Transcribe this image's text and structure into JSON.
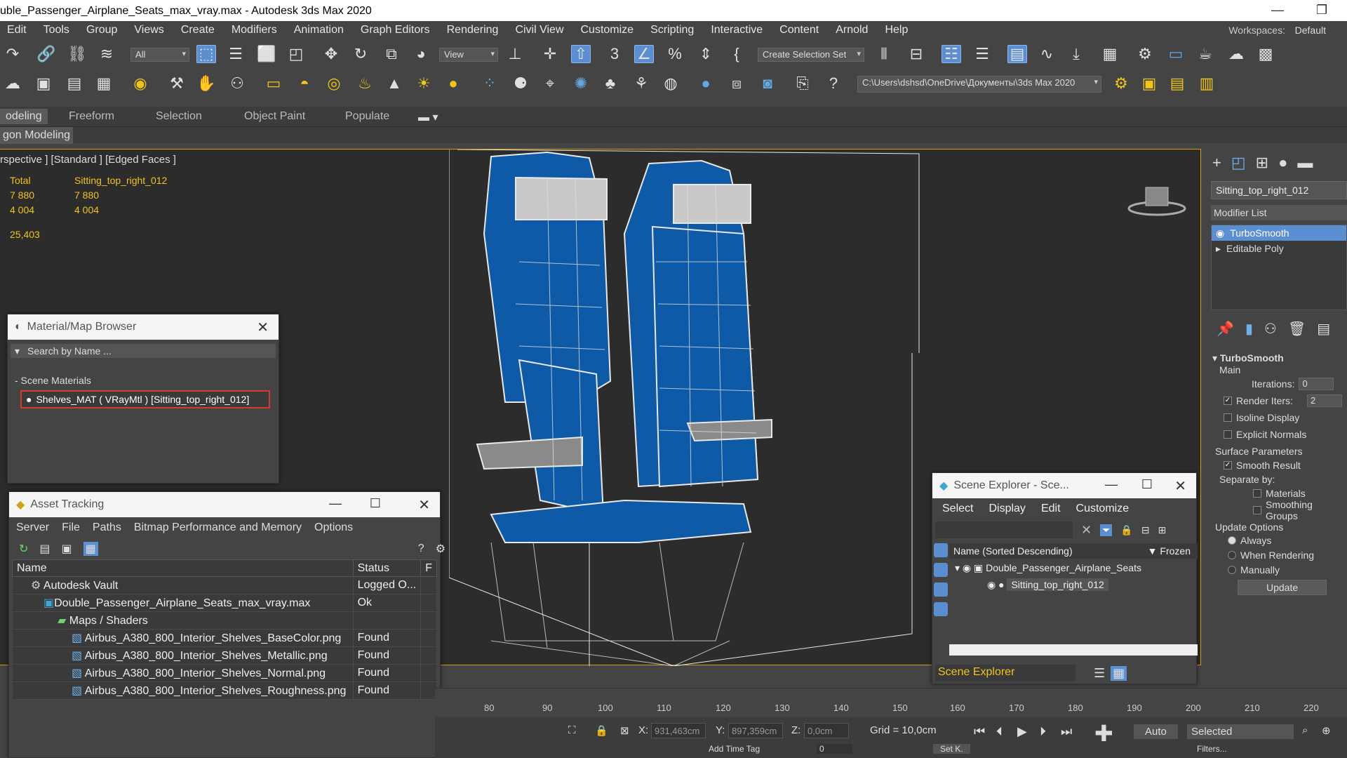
{
  "window": {
    "title": "uble_Passenger_Airplane_Seats_max_vray.max - Autodesk 3ds Max 2020",
    "min": "—",
    "max": "❐"
  },
  "menu": {
    "items": [
      "Edit",
      "Tools",
      "Group",
      "Views",
      "Create",
      "Modifiers",
      "Animation",
      "Graph Editors",
      "Rendering",
      "Civil View",
      "Customize",
      "Scripting",
      "Interactive",
      "Content",
      "Arnold",
      "Help"
    ],
    "workspaces_label": "Workspaces:",
    "workspaces_value": "Default"
  },
  "toolbar": {
    "filter": "All",
    "refcoord": "View",
    "selset": "Create Selection Set",
    "path": "C:\\Users\\dshsd\\OneDrive\\Документы\\3ds Max 2020"
  },
  "ribbon": {
    "tabs": [
      "odeling",
      "Freeform",
      "Selection",
      "Object Paint",
      "Populate"
    ],
    "sub": "gon Modeling"
  },
  "viewport": {
    "label": "rspective ] [Standard ] [Edged Faces ]",
    "stats": {
      "h1": "Total",
      "h2": "Sitting_top_right_012",
      "r1a": "7 880",
      "r1b": "7 880",
      "r2a": "4 004",
      "r2b": "4 004",
      "fps": "25,403"
    }
  },
  "cmd": {
    "object_name": "Sitting_top_right_012",
    "modifier_list": "Modifier List",
    "stack": [
      "TurboSmooth",
      "Editable Poly"
    ],
    "rollout": "TurboSmooth",
    "main": "Main",
    "iterations_label": "Iterations:",
    "iterations": "0",
    "render_iters_label": "Render Iters:",
    "render_iters": "2",
    "isoline": "Isoline Display",
    "explicit": "Explicit Normals",
    "surface": "Surface Parameters",
    "smooth": "Smooth Result",
    "separate": "Separate by:",
    "materials": "Materials",
    "smoothing": "Smoothing Groups",
    "update_opts": "Update Options",
    "always": "Always",
    "when_render": "When Rendering",
    "manually": "Manually",
    "update_btn": "Update"
  },
  "mmb": {
    "title": "Material/Map Browser",
    "search": "Search by Name ...",
    "category": "- Scene Materials",
    "material": "Shelves_MAT  ( VRayMtl )  [Sitting_top_right_012]"
  },
  "asset": {
    "title": "Asset Tracking",
    "menu": [
      "Server",
      "File",
      "Paths",
      "Bitmap Performance and Memory",
      "Options"
    ],
    "col_name": "Name",
    "col_status": "Status",
    "col_extra": "F",
    "rows": [
      {
        "name": "Autodesk Vault",
        "status": "Logged O...",
        "indent": 1
      },
      {
        "name": "Double_Passenger_Airplane_Seats_max_vray.max",
        "status": "Ok",
        "indent": 2
      },
      {
        "name": "Maps / Shaders",
        "status": "",
        "indent": 3
      },
      {
        "name": "Airbus_A380_800_Interior_Shelves_BaseColor.png",
        "status": "Found",
        "indent": 4
      },
      {
        "name": "Airbus_A380_800_Interior_Shelves_Metallic.png",
        "status": "Found",
        "indent": 4
      },
      {
        "name": "Airbus_A380_800_Interior_Shelves_Normal.png",
        "status": "Found",
        "indent": 4
      },
      {
        "name": "Airbus_A380_800_Interior_Shelves_Roughness.png",
        "status": "Found",
        "indent": 4
      }
    ]
  },
  "scene": {
    "title": "Scene Explorer - Sce...",
    "menu": [
      "Select",
      "Display",
      "Edit",
      "Customize"
    ],
    "col_name": "Name (Sorted Descending)",
    "col_frozen": "▼ Frozen",
    "root": "Double_Passenger_Airplane_Seats",
    "child": "Sitting_top_right_012",
    "footer": "Scene Explorer"
  },
  "timeline": {
    "ticks": [
      "80",
      "90",
      "100",
      "110",
      "120",
      "130",
      "140",
      "150",
      "160",
      "170",
      "180",
      "190",
      "200",
      "210",
      "220"
    ]
  },
  "status": {
    "x_label": "X:",
    "x": "931,463cm",
    "y_label": "Y:",
    "y": "897,359cm",
    "z_label": "Z:",
    "z": "0,0cm",
    "grid": "Grid = 10,0cm",
    "auto": "Auto",
    "selected": "Selected",
    "setk": "Set K.",
    "filters": "Filters...",
    "frame": "0",
    "addtime": "Add Time Tag"
  }
}
